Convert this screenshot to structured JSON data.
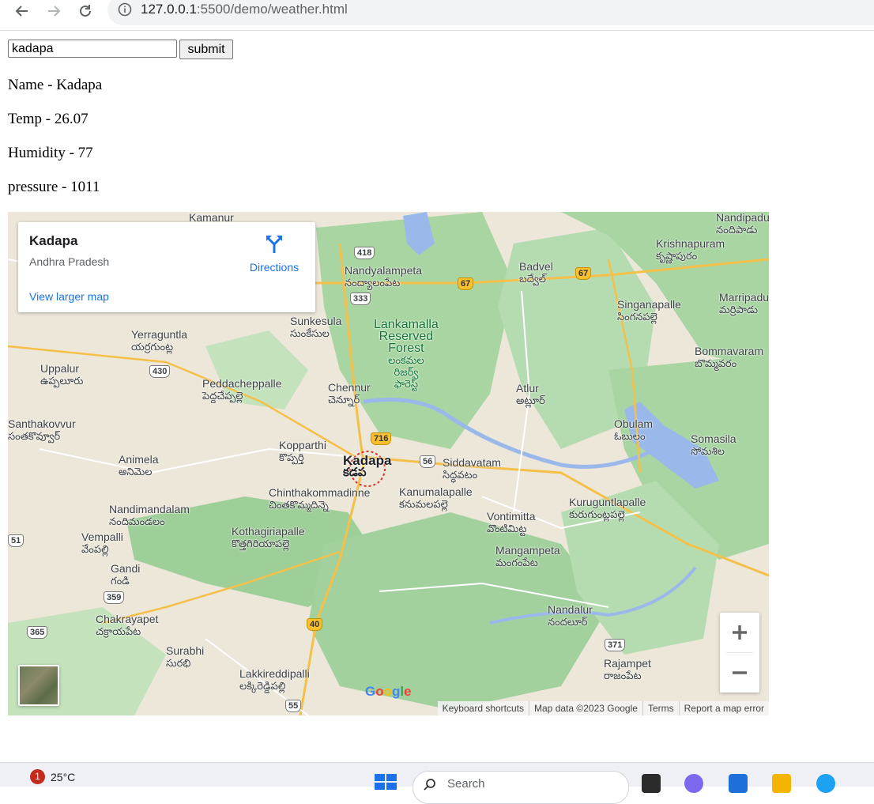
{
  "browser": {
    "url_host": "127.0.0.1",
    "url_path": ":5500/demo/weather.html"
  },
  "form": {
    "city_value": "kadapa",
    "submit_label": "submit"
  },
  "weather": {
    "name": "Name - Kadapa",
    "temp": "Temp - 26.07",
    "humidity": "Humidity - 77",
    "pressure": "pressure - 1011"
  },
  "map": {
    "place_card": {
      "title": "Kadapa",
      "subtitle": "Andhra Pradesh",
      "directions": "Directions",
      "view_larger": "View larger map"
    },
    "center_label": {
      "en": "Kadapa",
      "te": "కడప"
    },
    "forest_label": {
      "line1": "Lankamalla",
      "line2": "Reserved",
      "line3": "Forest",
      "te1": "లంకమల",
      "te2": "రిజర్వ్",
      "te3": "ఫారెస్ట్"
    },
    "places": [
      {
        "en": "Kamanur",
        "te": ""
      },
      {
        "en": "Nandipadu",
        "te": "నందిపాడు"
      },
      {
        "en": "Krishnapuram",
        "te": "కృష్ణాపురం"
      },
      {
        "en": "Nandyalampeta",
        "te": "నంద్యాలంపేట"
      },
      {
        "en": "Badvel",
        "te": "బద్వేల్"
      },
      {
        "en": "Singanapalle",
        "te": "సింగనపల్లె"
      },
      {
        "en": "Marripadu",
        "te": "మర్రిపాడు"
      },
      {
        "en": "Sunkesula",
        "te": "సుంకేసుల"
      },
      {
        "en": "Yerraguntla",
        "te": "యర్రగుంట్ల"
      },
      {
        "en": "Bommavaram",
        "te": "బొమ్మవరం"
      },
      {
        "en": "Uppalur",
        "te": "ఉప్పలూరు"
      },
      {
        "en": "Peddacheppalle",
        "te": "పెద్దచేప్పల్లె"
      },
      {
        "en": "Chennur",
        "te": "చెన్నూర్"
      },
      {
        "en": "Atlur",
        "te": "అట్లూర్"
      },
      {
        "en": "Santhakovvur",
        "te": "సంతకొవ్వూర్"
      },
      {
        "en": "Obulam",
        "te": "ఓబులం"
      },
      {
        "en": "Somasila",
        "te": "సోమశిల"
      },
      {
        "en": "Kopparthi",
        "te": "కొప్పర్తి"
      },
      {
        "en": "Animela",
        "te": "అనిమెల"
      },
      {
        "en": "Siddavatam",
        "te": "సిద్ధవటం"
      },
      {
        "en": "Chinthakommadinne",
        "te": "చింతకొమ్మదిన్నె"
      },
      {
        "en": "Kanumalapalle",
        "te": "కనుమలపల్లె"
      },
      {
        "en": "Nandimandalam",
        "te": "నందిమండలం"
      },
      {
        "en": "Vontimitta",
        "te": "వొంటిమిట్ట"
      },
      {
        "en": "Kuruguntlapalle",
        "te": "కురుగుంట్లపల్లె"
      },
      {
        "en": "Vempalli",
        "te": "వేంపల్లి"
      },
      {
        "en": "Kothagiriapalle",
        "te": "కొత్తగిరియాపల్లె"
      },
      {
        "en": "Gandi",
        "te": "గండి"
      },
      {
        "en": "Mangampeta",
        "te": "మంగంపేట"
      },
      {
        "en": "Chakrayapet",
        "te": "చక్రాయపేట"
      },
      {
        "en": "Nandalur",
        "te": "నందలూర్"
      },
      {
        "en": "Surabhi",
        "te": "సురభి"
      },
      {
        "en": "Rajampet",
        "te": "రాజంపేట"
      },
      {
        "en": "Lakkireddipalli",
        "te": "లక్కిరెడ్డిపల్లి"
      }
    ],
    "shields": [
      "418",
      "333",
      "67",
      "67",
      "430",
      "716",
      "56",
      "359",
      "365",
      "40",
      "371",
      "55",
      "51"
    ],
    "attribution": [
      "Keyboard shortcuts",
      "Map data ©2023 Google",
      "Terms",
      "Report a map error"
    ],
    "google": "Google"
  },
  "taskbar": {
    "badge": "1",
    "temp": "25°C",
    "search_placeholder": "Search"
  },
  "colors": {
    "forest": "#a8d5a2",
    "land": "#ede7da",
    "water": "#9ab9ea",
    "link": "#1a73e8"
  }
}
